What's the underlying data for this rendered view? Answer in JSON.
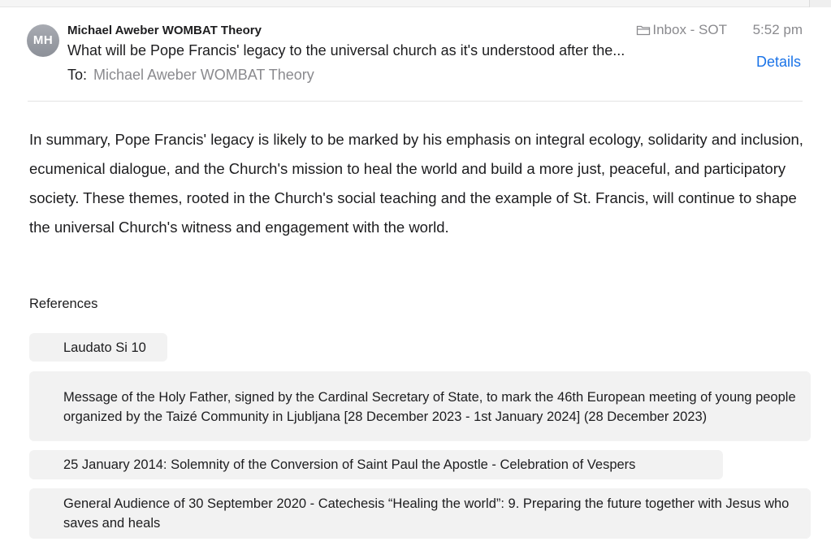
{
  "email": {
    "avatar_initials": "MH",
    "from": "Michael Aweber WOMBAT Theory",
    "mailbox": "Inbox - SOT",
    "time": "5:52 pm",
    "subject": "What will be Pope Francis' legacy to the universal church as it's understood after the...",
    "details_label": "Details",
    "to_label": "To:",
    "to_value": "Michael Aweber WOMBAT Theory",
    "body": "In summary, Pope Francis' legacy is likely to be marked by his emphasis on integral ecology, solidarity and inclusion, ecumenical dialogue, and the Church's mission to heal the world and build a more just, peaceful, and participatory society. These themes, rooted in the Church's social teaching and the example of St. Francis, will continue to shape the universal Church's witness and engagement with the world."
  },
  "references": {
    "heading": "References",
    "items": [
      "Laudato Si 10",
      "Message of the Holy Father, signed by the Cardinal Secretary of State, to mark the 46th European meeting of young people organized by the Taizé Community in Ljubljana [28 December 2023 - 1st January 2024] (28 December 2023)",
      "25 January 2014: Solemnity of the Conversion of Saint Paul the Apostle - Celebration of Vespers",
      "General Audience of 30 September 2020 - Catechesis “Healing the world”: 9. Preparing the future together with Jesus who saves and heals"
    ]
  },
  "colors": {
    "link": "#1a73e8",
    "muted": "#8a8a8e",
    "reference_bg": "#f2f2f2",
    "avatar_bg": "#9a9ea6"
  },
  "icons": {
    "mailbox": "folder-icon"
  }
}
